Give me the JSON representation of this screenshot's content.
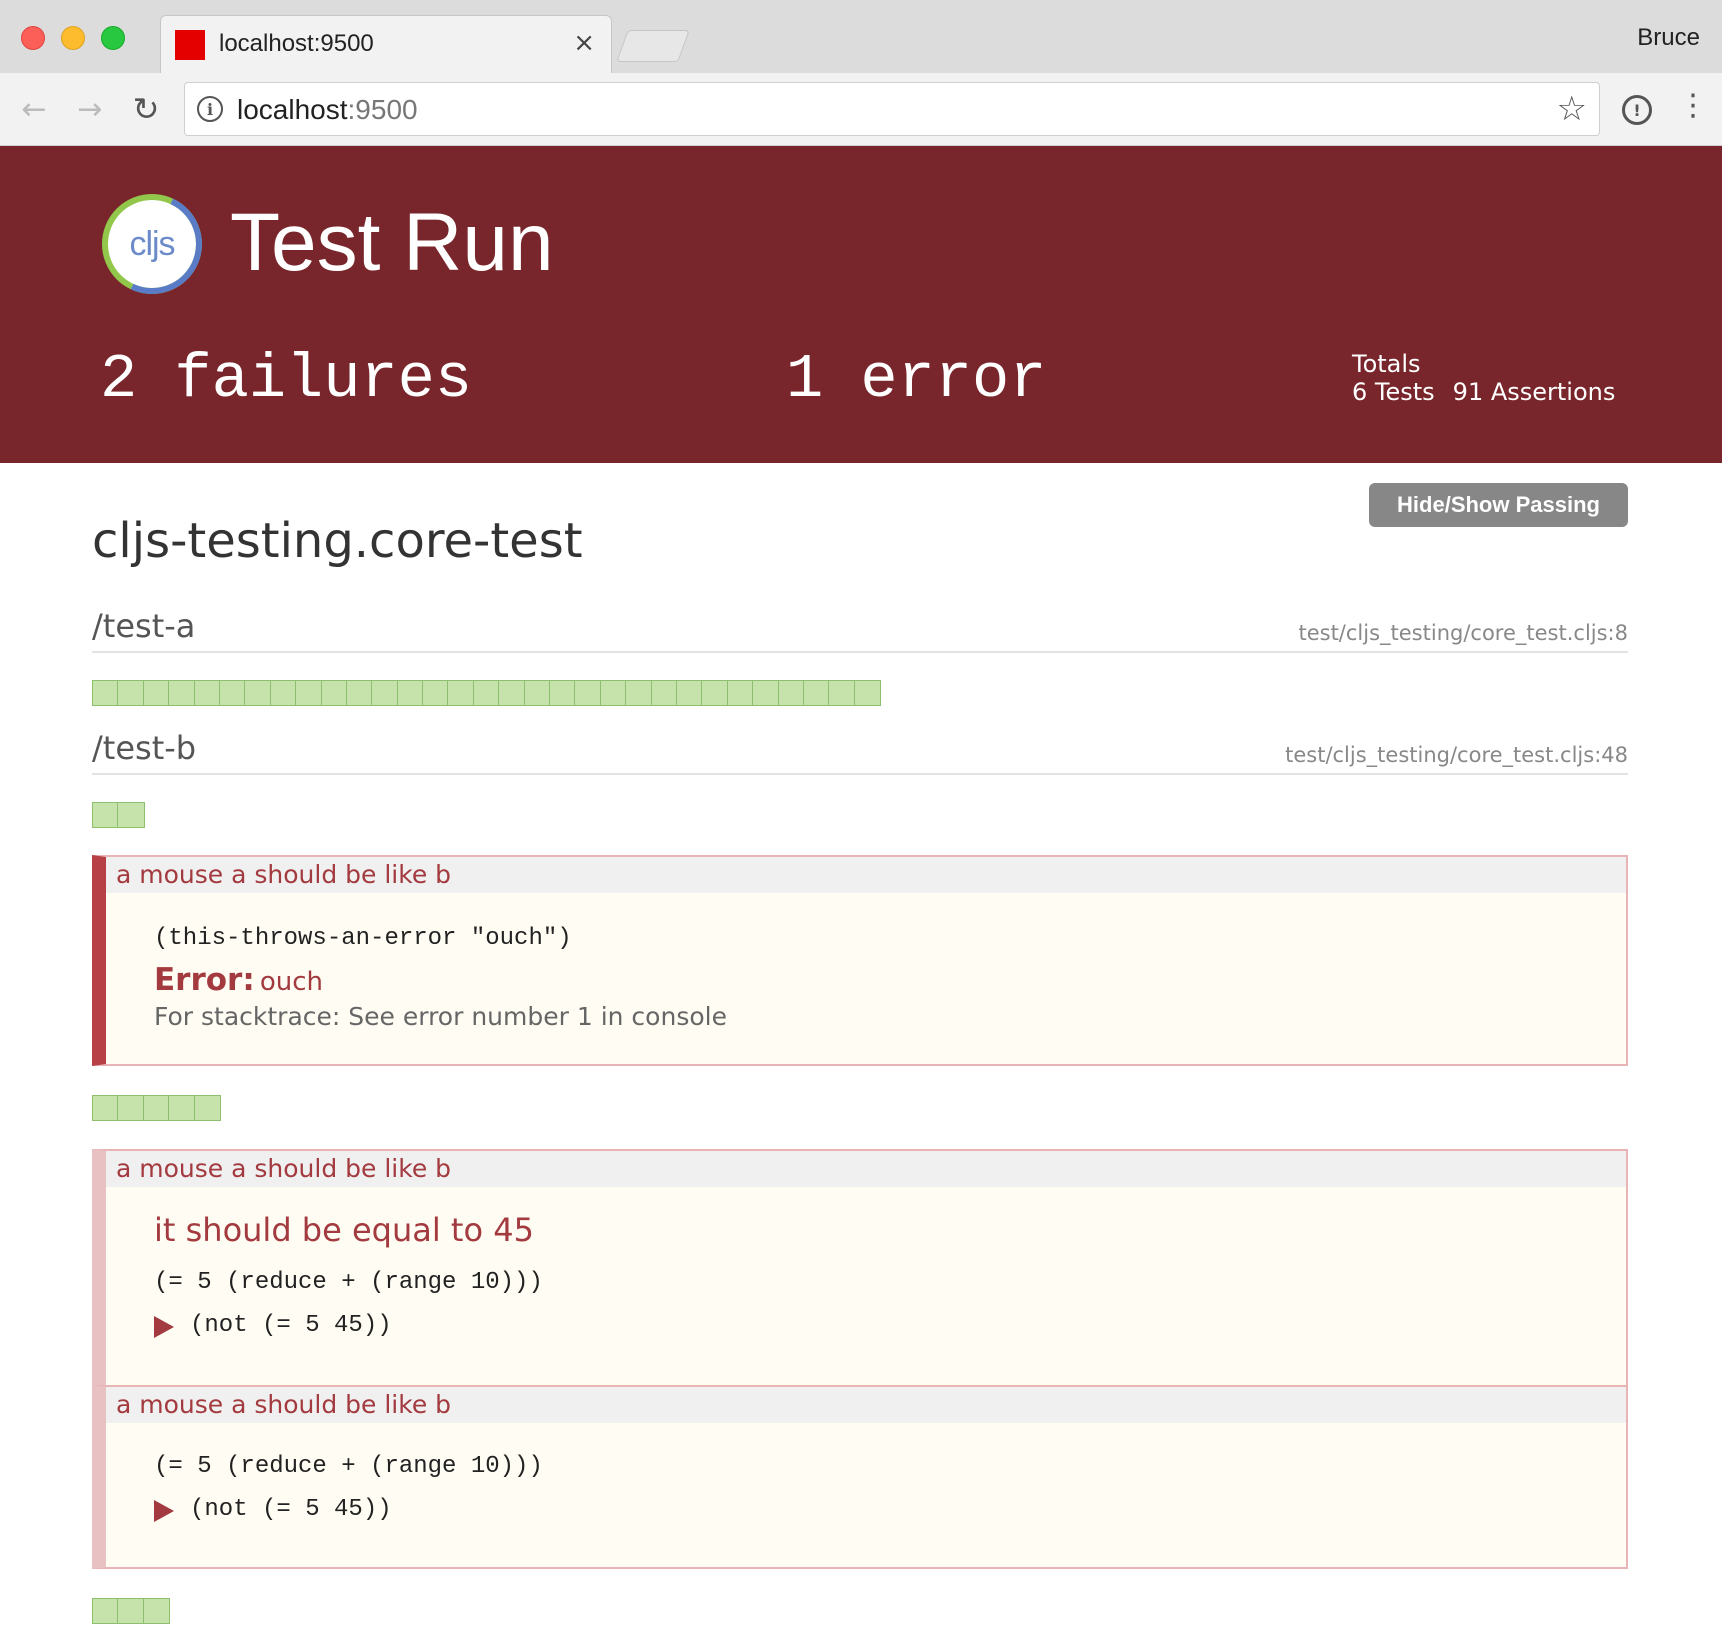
{
  "browser": {
    "tab_title": "localhost:9500",
    "tab_close": "×",
    "profile_name": "Bruce",
    "url_host": "localhost",
    "url_port": ":9500",
    "back_icon": "←",
    "forward_icon": "→",
    "reload_icon": "↻",
    "star_icon": "☆",
    "menu_icon": "⋮"
  },
  "header": {
    "logo_text": "cljs",
    "title": "Test Run",
    "failures": "2 failures",
    "errors": "1 error",
    "totals_label": "Totals",
    "tests": "6 Tests",
    "assertions": "91 Assertions",
    "background_color": "#78262b"
  },
  "content": {
    "toggle_button": "Hide/Show Passing",
    "namespace": "cljs-testing.core-test",
    "tests": [
      {
        "name": "/test-a",
        "location": "test/cljs_testing/core_test.cljs:8",
        "passing_assertions": 31
      },
      {
        "name": "/test-b",
        "location": "test/cljs_testing/core_test.cljs:48",
        "passing_before_error": 2,
        "error": {
          "context": "a mouse a should be like b",
          "expr": "(this-throws-an-error \"ouch\")",
          "label": "Error:",
          "message": "ouch",
          "stacktrace": "For stacktrace: See error number 1 in console"
        },
        "passing_after_error": 5,
        "failure_1": {
          "context": "a mouse a should be like b",
          "message": "it should be equal to 45",
          "expr": "(= 5 (reduce + (range 10)))",
          "actual": "(not (= 5 45))"
        },
        "failure_2": {
          "context": "a mouse a should be like b",
          "expr": "(= 5 (reduce + (range 10)))",
          "actual": "(not (= 5 45))"
        },
        "passing_after_failures": 3
      }
    ]
  }
}
